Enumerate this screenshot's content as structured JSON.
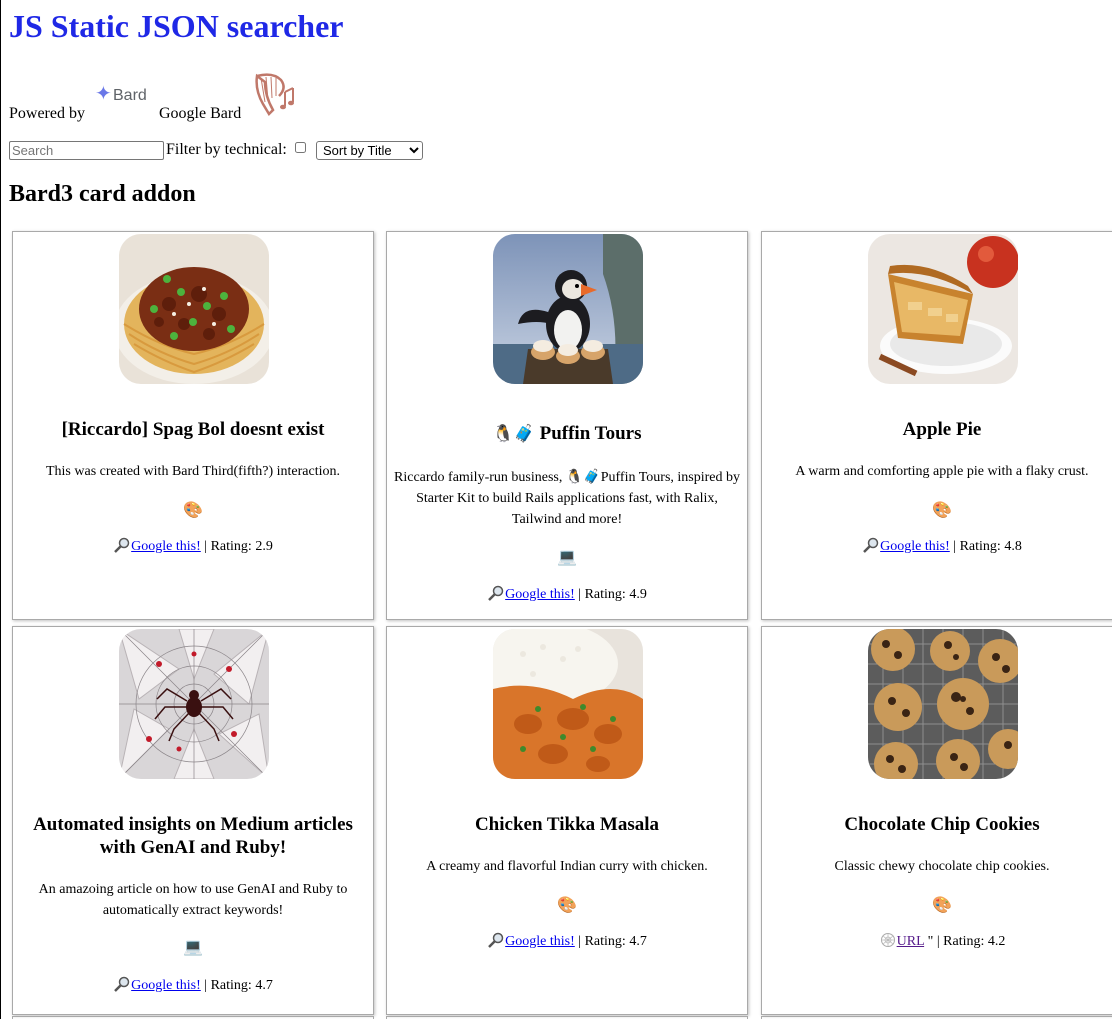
{
  "header": {
    "title": "JS Static JSON searcher"
  },
  "powered": {
    "prefix": "Powered by",
    "bard_word": "Bard",
    "suffix": "Google Bard"
  },
  "controls": {
    "search_placeholder": "Search",
    "filter_label": "Filter by technical:",
    "sort_selected": "Sort by Title"
  },
  "section": {
    "title": "Bard3 card addon"
  },
  "cards": [
    {
      "title": "[Riccardo] Spag Bol doesnt exist",
      "title_emoji": "",
      "description": "This was created with Bard Third(fifth?) interaction.",
      "emoji": "🎨",
      "link_icon": "magnifier-icon",
      "link_label": "Google this!",
      "rating": "Rating: 2.9",
      "image": "spaghetti-bolognese"
    },
    {
      "title": "Puffin Tours",
      "title_emoji": "🐧🧳",
      "description": "Riccardo family-run business, 🐧🧳Puffin Tours, inspired by Starter Kit to build Rails applications fast, with Ralix, Tailwind and more!",
      "emoji": "💻",
      "link_icon": "magnifier-icon",
      "link_label": "Google this!",
      "rating": "Rating: 4.9",
      "image": "puffin-cupcakes"
    },
    {
      "title": "Apple Pie",
      "title_emoji": "",
      "description": "A warm and comforting apple pie with a flaky crust.",
      "emoji": "🎨",
      "link_icon": "magnifier-icon",
      "link_label": "Google this!",
      "rating": "Rating: 4.8",
      "image": "apple-pie"
    },
    {
      "title": "Automated insights on Medium articles with GenAI and Ruby!",
      "title_emoji": "",
      "description": "An amazoing article on how to use GenAI and Ruby to automatically extract keywords!",
      "emoji": "💻",
      "link_icon": "magnifier-icon",
      "link_label": "Google this!",
      "rating": "Rating: 4.7",
      "image": "spider-web"
    },
    {
      "title": "Chicken Tikka Masala",
      "title_emoji": "",
      "description": "A creamy and flavorful Indian curry with chicken.",
      "emoji": "🎨",
      "link_icon": "magnifier-icon",
      "link_label": "Google this!",
      "rating": "Rating: 4.7",
      "image": "tikka-masala"
    },
    {
      "title": "Chocolate Chip Cookies",
      "title_emoji": "",
      "description": "Classic chewy chocolate chip cookies.",
      "emoji": "🎨",
      "link_icon": "web-icon",
      "link_label": "URL",
      "link_suffix": " \"",
      "rating": "Rating: 4.2",
      "image": "cookies"
    }
  ],
  "colors": {
    "title_blue": "#1f28e6",
    "link": "#0000ee",
    "visited": "#551a8b"
  }
}
